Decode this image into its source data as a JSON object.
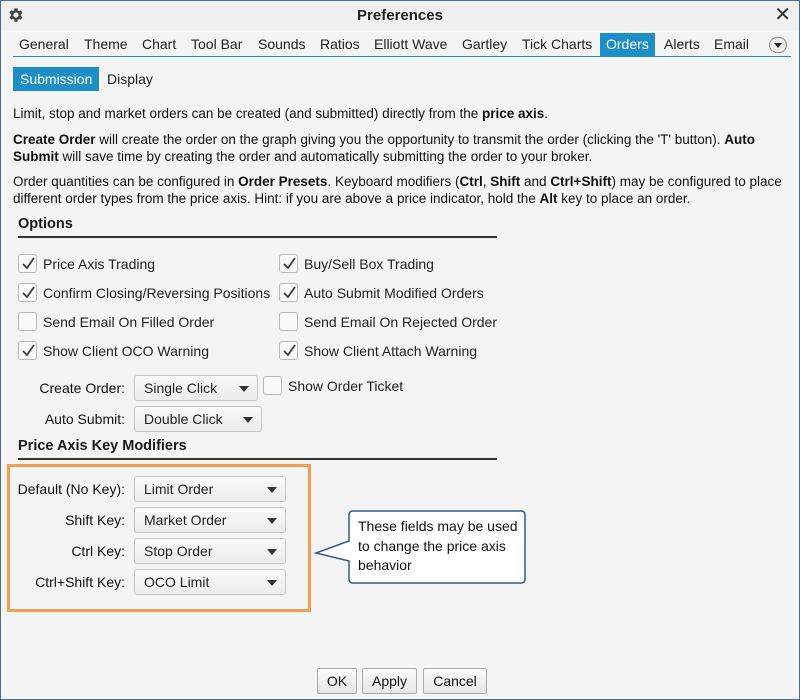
{
  "window": {
    "title": "Preferences",
    "close_glyph": "✕",
    "settings_icon": "gear-icon"
  },
  "tabs": [
    {
      "label": "General"
    },
    {
      "label": "Theme"
    },
    {
      "label": "Chart"
    },
    {
      "label": "Tool Bar"
    },
    {
      "label": "Sounds"
    },
    {
      "label": "Ratios"
    },
    {
      "label": "Elliott Wave"
    },
    {
      "label": "Gartley"
    },
    {
      "label": "Tick Charts"
    },
    {
      "label": "Orders"
    },
    {
      "label": "Alerts"
    },
    {
      "label": "Email"
    }
  ],
  "active_tab": "Orders",
  "subtabs": [
    {
      "label": "Submission"
    },
    {
      "label": "Display"
    }
  ],
  "active_subtab": "Submission",
  "intro": {
    "p1_text": "Limit, stop and market orders can be created (and submitted) directly from the ",
    "p1_bold": "price axis",
    "p1_end": ".",
    "p2_bold1": "Create Order",
    "p2_text1": " will create the order on the graph giving you the opportunity to transmit the order (clicking the 'T' button).  ",
    "p2_bold2": "Auto Submit",
    "p2_text2": " will save time by creating the order and automatically submitting the order to your broker.",
    "p3_text1": "Order quantities can be configured in ",
    "p3_bold1": "Order Presets",
    "p3_text2": ".  Keyboard modifiers (",
    "p3_bold2": "Ctrl",
    "p3_text3": ", ",
    "p3_bold3": "Shift",
    "p3_text4": " and ",
    "p3_bold4": "Ctrl+Shift",
    "p3_text5": ") may be configured to place different order types from the price axis.  Hint: if you are above a price indicator, hold the ",
    "p3_bold5": "Alt",
    "p3_text6": " key to place an order."
  },
  "options": {
    "heading": "Options",
    "checkboxes": [
      {
        "label": "Price Axis Trading",
        "checked": true
      },
      {
        "label": "Buy/Sell Box Trading",
        "checked": true
      },
      {
        "label": "Confirm Closing/Reversing Positions",
        "checked": true
      },
      {
        "label": "Auto Submit Modified Orders",
        "checked": true
      },
      {
        "label": "Send Email On Filled Order",
        "checked": false
      },
      {
        "label": "Send Email On Rejected Order",
        "checked": false
      },
      {
        "label": "Show Client OCO Warning",
        "checked": true
      },
      {
        "label": "Show Client Attach Warning",
        "checked": true
      }
    ],
    "create_order_label": "Create Order:",
    "create_order_value": "Single Click",
    "show_ticket_label": "Show Order Ticket",
    "show_ticket_checked": false,
    "auto_submit_label": "Auto Submit:",
    "auto_submit_value": "Double Click"
  },
  "modifiers": {
    "heading": "Price Axis Key Modifiers",
    "rows": [
      {
        "label": "Default (No Key):",
        "value": "Limit Order"
      },
      {
        "label": "Shift Key:",
        "value": "Market Order"
      },
      {
        "label": "Ctrl Key:",
        "value": "Stop Order"
      },
      {
        "label": "Ctrl+Shift Key:",
        "value": "OCO Limit"
      }
    ]
  },
  "callout": {
    "text": "These fields may be used to change the price axis behavior"
  },
  "buttons": {
    "ok": "OK",
    "apply": "Apply",
    "cancel": "Cancel"
  },
  "colors": {
    "accent": "#1e8fc6",
    "highlight": "#f0a050",
    "callout_border": "#2e5b86"
  }
}
